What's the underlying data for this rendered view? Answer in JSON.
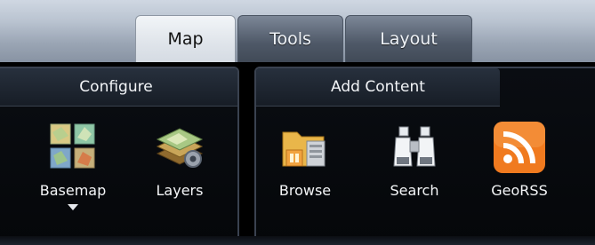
{
  "tabs": [
    {
      "label": "Map",
      "active": true
    },
    {
      "label": "Tools",
      "active": false
    },
    {
      "label": "Layout",
      "active": false
    }
  ],
  "groups": {
    "configure": {
      "title": "Configure",
      "tools": [
        {
          "label": "Basemap",
          "icon": "basemap-grid-icon",
          "has_dropdown": true
        },
        {
          "label": "Layers",
          "icon": "layers-icon"
        }
      ]
    },
    "add_content": {
      "title": "Add Content",
      "tools": [
        {
          "label": "Browse",
          "icon": "folder-icon"
        },
        {
          "label": "Search",
          "icon": "binoculars-icon"
        },
        {
          "label": "GeoRSS",
          "icon": "rss-icon"
        }
      ]
    }
  },
  "colors": {
    "rss_orange": "#f07a1f",
    "panel_bg": "#05070a",
    "header_text": "#f2f4f7"
  }
}
